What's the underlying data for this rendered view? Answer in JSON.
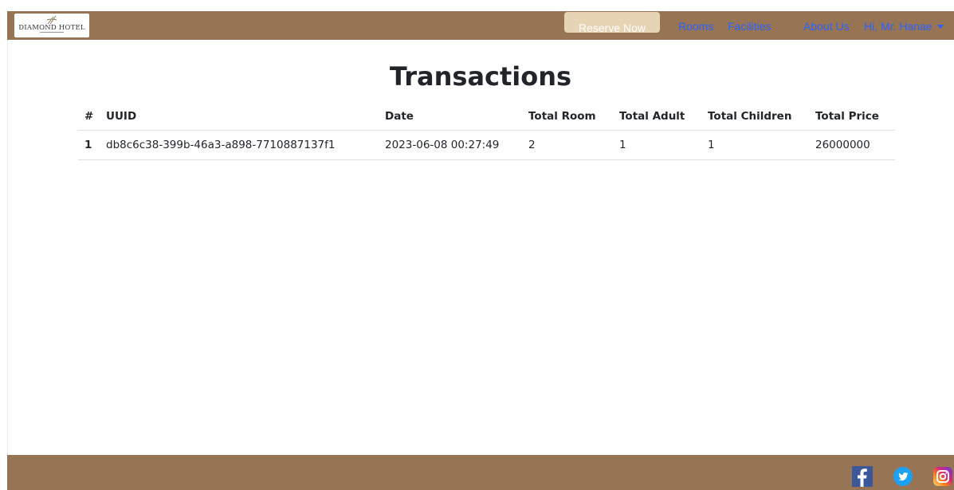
{
  "navbar": {
    "brand": {
      "name": "DIAMOND HOTEL",
      "logo_icon": "diamond-hotel-logo-icon"
    },
    "reserve_label": "Reserve Now",
    "links": {
      "rooms": "Rooms",
      "facilities": "Facilities",
      "about": "About Us"
    },
    "user_menu": {
      "label": "Hi, Mr. Hanae",
      "icon": "chevron-down-icon"
    },
    "colors": {
      "bar": "#977453",
      "link": "#2a62ff",
      "reserve_bg": "#e6d4b5"
    }
  },
  "main": {
    "title": "Transactions",
    "table": {
      "headers": {
        "index": "#",
        "uuid": "UUID",
        "date": "Date",
        "total_room": "Total Room",
        "total_adult": "Total Adult",
        "total_children": "Total Children",
        "total_price": "Total Price"
      },
      "rows": [
        {
          "index": "1",
          "uuid": "db8c6c38-399b-46a3-a898-7710887137f1",
          "date": "2023-06-08 00:27:49",
          "total_room": "2",
          "total_adult": "1",
          "total_children": "1",
          "total_price": "26000000"
        }
      ]
    }
  },
  "footer": {
    "social": [
      "facebook-icon",
      "twitter-icon",
      "instagram-icon"
    ],
    "colors": {
      "bar": "#977453",
      "facebook": "#3b5998",
      "twitter": "#1da1f2",
      "instagram": "#c13584"
    }
  }
}
